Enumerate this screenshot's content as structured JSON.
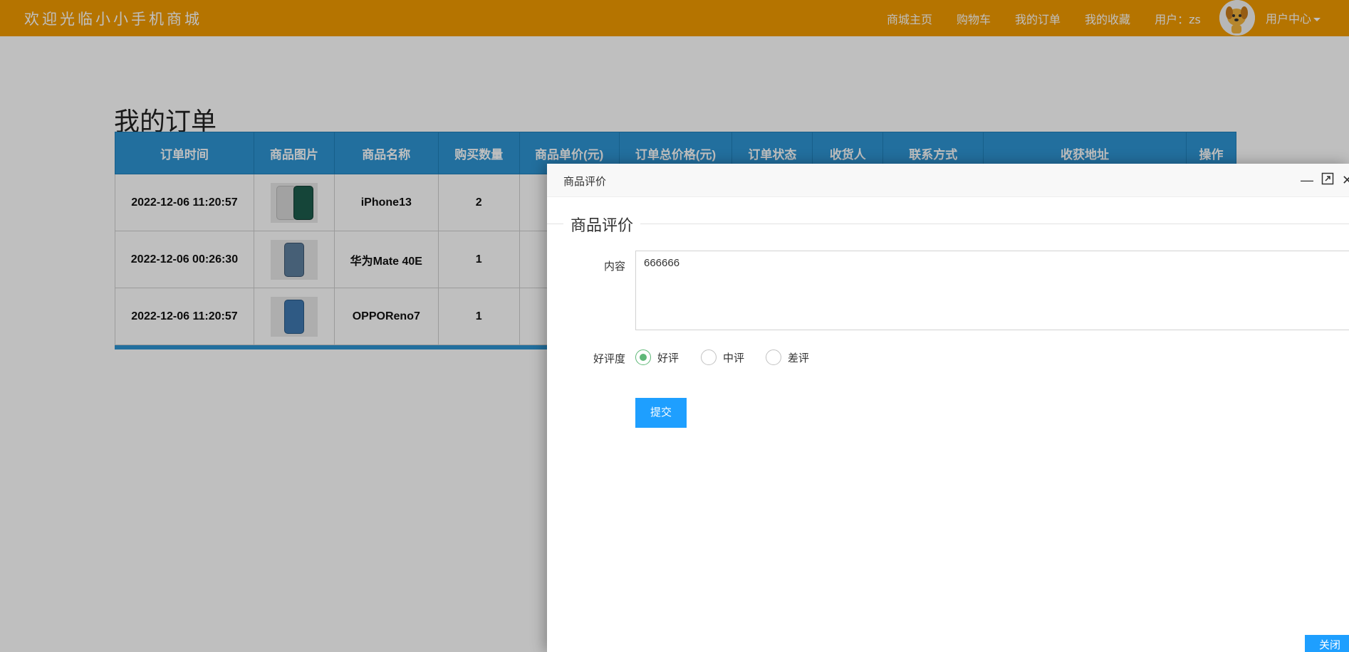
{
  "header": {
    "brand": "欢迎光临小小手机商城",
    "nav": [
      "商城主页",
      "购物车",
      "我的订单",
      "我的收藏",
      "用户：zs"
    ],
    "user_center": "用户中心"
  },
  "page": {
    "title": "我的订单"
  },
  "orders": {
    "columns": [
      "订单时间",
      "商品图片",
      "商品名称",
      "购买数量",
      "商品单价(元)",
      "订单总价格(元)",
      "订单状态",
      "收货人",
      "联系方式",
      "收获地址",
      "操作"
    ],
    "rows": [
      {
        "time": "2022-12-06 11:20:57",
        "name": "iPhone13",
        "qty": "2"
      },
      {
        "time": "2022-12-06 00:26:30",
        "name": "华为Mate 40E",
        "qty": "1"
      },
      {
        "time": "2022-12-06 11:20:57",
        "name": "OPPOReno7",
        "qty": "1"
      }
    ]
  },
  "dialog": {
    "title": "商品评价",
    "legend": "商品评价",
    "content_label": "内容",
    "content_value": "666666",
    "rating_label": "好评度",
    "ratings": [
      "好评",
      "中评",
      "差评"
    ],
    "selected_rating": "好评",
    "submit_label": "提交",
    "close_label": "关闭"
  },
  "colors": {
    "topbar": "#f29b00",
    "table_header": "#2e95d3",
    "primary_button": "#1e9fff",
    "radio_checked": "#5fb878"
  }
}
